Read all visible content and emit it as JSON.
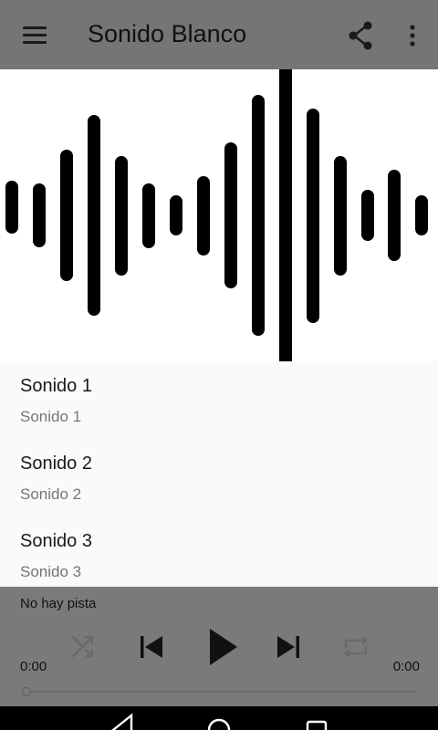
{
  "toolbar": {
    "title": "Sonido Blanco",
    "menu_icon": "hamburger-menu-icon",
    "share_icon": "share-icon",
    "more_icon": "more-vert-icon"
  },
  "hero": {
    "image": "sound-wave-illustration"
  },
  "list": {
    "items": [
      {
        "title": "Sonido 1",
        "subtitle": "Sonido 1"
      },
      {
        "title": "Sonido 2",
        "subtitle": "Sonido 2"
      },
      {
        "title": "Sonido 3",
        "subtitle": "Sonido 3"
      }
    ]
  },
  "player": {
    "track": "No hay pista",
    "elapsed": "0:00",
    "duration": "0:00",
    "progress": 0,
    "icons": [
      "shuffle-icon",
      "skip-previous-icon",
      "play-icon",
      "skip-next-icon",
      "repeat-icon"
    ]
  },
  "navbar": {
    "icons": [
      "back-icon",
      "home-icon",
      "recents-icon"
    ]
  },
  "colors": {
    "toolbar": "#757575",
    "player": "#7a7a7a",
    "background": "#fafafa",
    "wave": "#000000"
  }
}
